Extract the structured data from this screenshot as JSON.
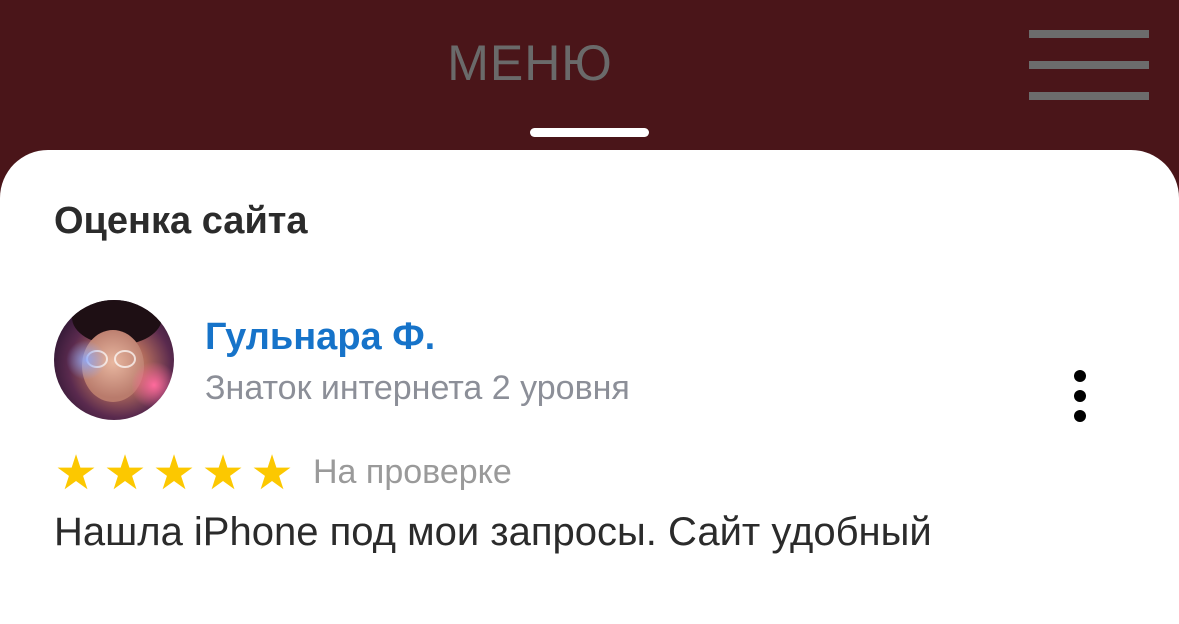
{
  "header": {
    "title": "МЕНЮ",
    "menu_icon": "hamburger-icon",
    "background_color": "#4a1519"
  },
  "review": {
    "section_title": "Оценка сайта",
    "user": {
      "name": "Гульнара Ф.",
      "level": "Знаток интернета 2 уровня",
      "name_color": "#1673c9"
    },
    "more_icon": "more-vertical-icon",
    "rating": {
      "value": 5,
      "max": 5,
      "star_color": "#fcc800"
    },
    "status": "На проверке",
    "text": "Нашла iPhone под мои запросы. Сайт удобный"
  }
}
